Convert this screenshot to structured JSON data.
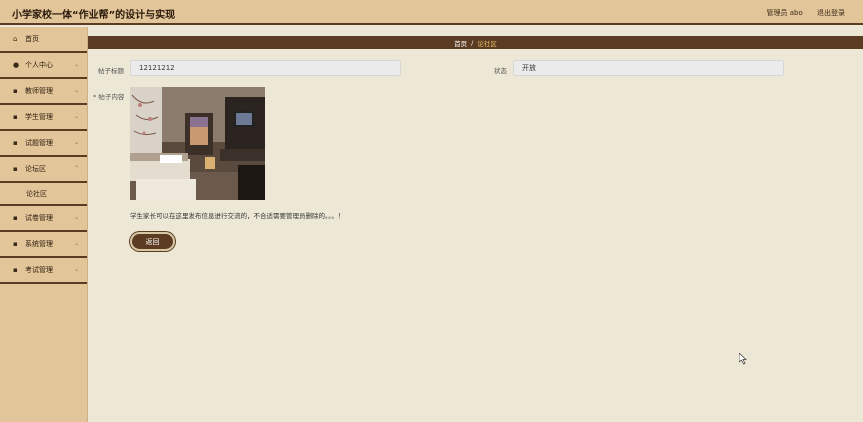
{
  "header": {
    "title": "小学家校一体“作业帮”的设计与实现",
    "user_label": "管理员 abo",
    "logout_label": "退出登录"
  },
  "sidebar": {
    "items": [
      {
        "label": "首页",
        "icon": "home-icon"
      },
      {
        "label": "个人中心",
        "icon": "user-icon"
      },
      {
        "label": "教师管理",
        "icon": "grid-icon"
      },
      {
        "label": "学生管理",
        "icon": "grid-icon"
      },
      {
        "label": "试题管理",
        "icon": "grid-icon"
      },
      {
        "label": "论坛区",
        "icon": "grid-icon"
      },
      {
        "label": "试卷管理",
        "icon": "grid-icon"
      },
      {
        "label": "系统管理",
        "icon": "grid-icon"
      },
      {
        "label": "考试管理",
        "icon": "grid-icon"
      }
    ],
    "forum_sub_label": "论社区"
  },
  "breadcrumb": {
    "home": "首页",
    "separator": "/",
    "current": "论社区"
  },
  "form": {
    "title_label": "帖子标题",
    "title_value": "12121212",
    "status_label": "状态",
    "status_value": "开放",
    "content_label": "帖子内容",
    "content_text": "学生家长可以在这里发布信息进行交流的，不合适需要管理员删除的。。。！",
    "back_button": "返回"
  }
}
